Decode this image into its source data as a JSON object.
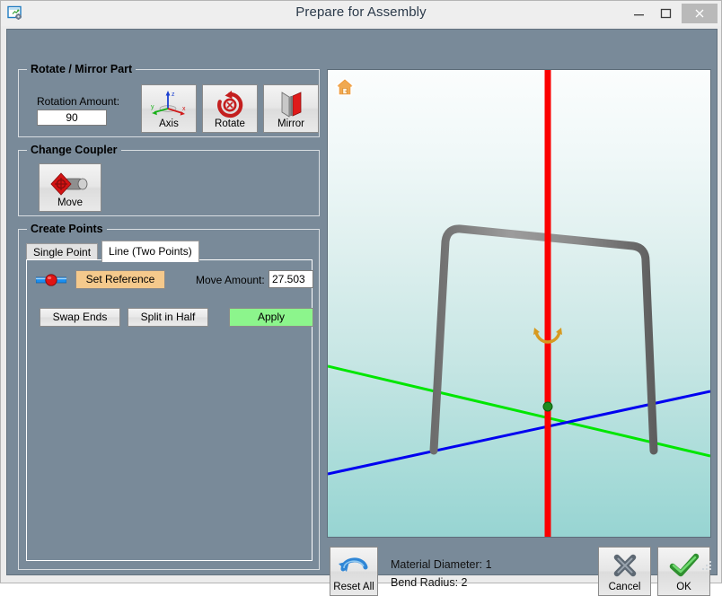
{
  "window": {
    "title": "Prepare for Assembly",
    "app_icon": "form-settings-icon",
    "minimize_label": "Minimize",
    "maximize_label": "Maximize",
    "close_label": "Close"
  },
  "rotate_mirror": {
    "group_title": "Rotate / Mirror Part",
    "rotation_label": "Rotation Amount:",
    "rotation_value": "90",
    "buttons": [
      {
        "label": "Axis",
        "icon": "axis-triad-icon"
      },
      {
        "label": "Rotate",
        "icon": "rotate-arrow-icon"
      },
      {
        "label": "Mirror",
        "icon": "mirror-planes-icon"
      }
    ]
  },
  "change_coupler": {
    "group_title": "Change Coupler",
    "move_button": {
      "label": "Move",
      "icon": "coupler-move-icon"
    }
  },
  "create_points": {
    "group_title": "Create Points",
    "tabs": [
      {
        "label": "Single Point",
        "active": false
      },
      {
        "label": "Line (Two Points)",
        "active": true
      }
    ],
    "reference_icon": "line-reference-point-icon",
    "set_reference_label": "Set Reference",
    "move_amount_label": "Move Amount:",
    "move_amount_value": "27.503",
    "swap_ends_label": "Swap Ends",
    "split_in_half_label": "Split in Half",
    "apply_label": "Apply"
  },
  "viewport": {
    "home_icon": "home-view-icon",
    "axes": {
      "vertical_color": "#fb0000",
      "green_color": "#00e600",
      "blue_color": "#0000f0",
      "origin_color": "#1f8a1f",
      "rotation_marker_color": "#d79a20"
    },
    "part_color": "#7b7b7b"
  },
  "footer": {
    "reset_all": {
      "label": "Reset All",
      "icon": "undo-arrow-icon"
    },
    "material_diameter": "Material Diameter: 1",
    "bend_radius": "Bend Radius: 2",
    "cancel": {
      "label": "Cancel",
      "icon": "x-mark-icon"
    },
    "ok": {
      "label": "OK",
      "icon": "check-mark-icon"
    }
  },
  "colors": {
    "panel_background": "#798a99",
    "accent_apply": "#8cf58c",
    "accent_reference": "#f5c98c",
    "title_text": "#2b3a4a"
  }
}
